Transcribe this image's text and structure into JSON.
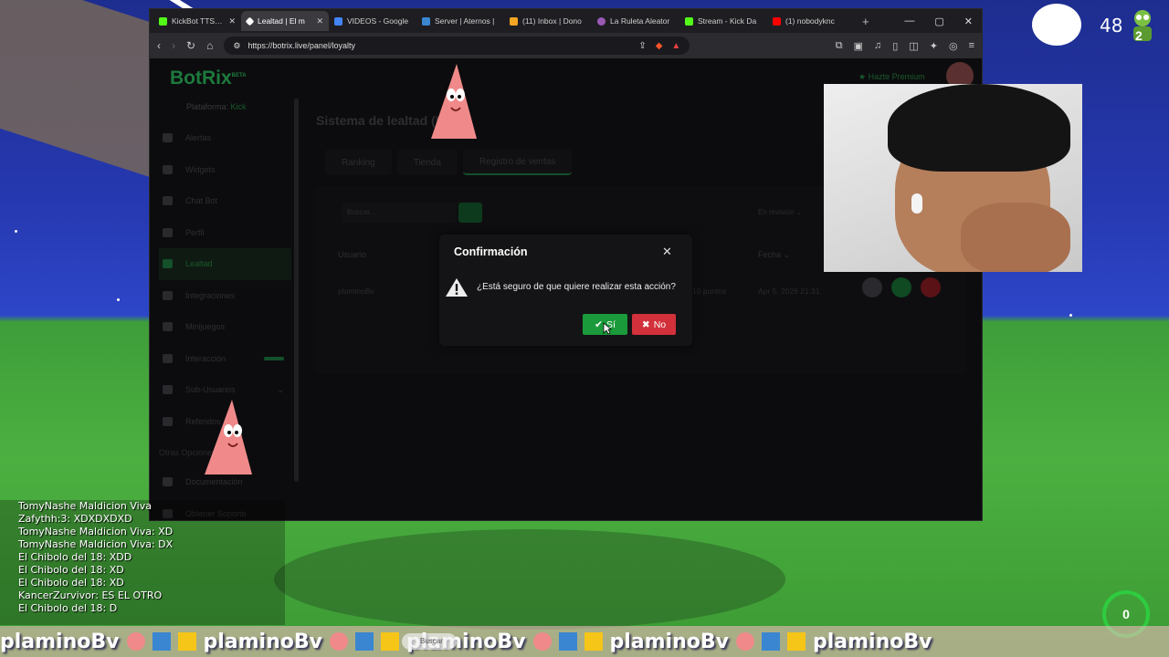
{
  "browser": {
    "tabs": [
      {
        "label": "KickBot TTS Com",
        "color": "#53fc18",
        "active": false
      },
      {
        "label": "Lealtad | El m",
        "color": "#ffffff",
        "active": true
      },
      {
        "label": "VIDEOS - Google",
        "color": "#4285f4",
        "active": false
      },
      {
        "label": "Server | Aternos |",
        "color": "#3a86d1",
        "active": false
      },
      {
        "label": "(11) Inbox | Dono",
        "color": "#f5a623",
        "active": false
      },
      {
        "label": "La Ruleta Aleator",
        "color": "#9b59b6",
        "active": false
      },
      {
        "label": "Stream - Kick Da",
        "color": "#53fc18",
        "active": false
      },
      {
        "label": "(1) nobodyknc",
        "color": "#ff0000",
        "active": false
      }
    ],
    "url": "https://botrix.live/panel/loyalty"
  },
  "page": {
    "logo": "BotRix",
    "logo_badge": "BETA",
    "platform_label": "Plataforma:",
    "platform_value": "Kick",
    "premium": "Hazte Premium",
    "title": "Sistema de lealtad",
    "title_suffix": "(Kick)",
    "sidebar": [
      {
        "label": "Alertas",
        "active": false
      },
      {
        "label": "Widgets",
        "active": false
      },
      {
        "label": "Chat Bot",
        "active": false
      },
      {
        "label": "Perfil",
        "active": false
      },
      {
        "label": "Lealtad",
        "active": true
      },
      {
        "label": "Integraciones",
        "active": false
      },
      {
        "label": "Minijuegos",
        "active": false
      },
      {
        "label": "Interacción",
        "active": false
      },
      {
        "label": "Sub-Usuarios",
        "active": false
      },
      {
        "label": "Referidos",
        "active": false
      }
    ],
    "sidebar_section": "Otras Opciones",
    "sidebar_extra": [
      "Documentación",
      "Obtener Soporte"
    ],
    "tabs": [
      "Ranking",
      "Tienda",
      "Registro de ventas"
    ],
    "search_placeholder": "Buscar...",
    "filter_select": "En revisión",
    "table_headers": {
      "user": "Usuario",
      "date": "Fecha"
    },
    "row": {
      "user": "plaminoBv",
      "points": "10 puntos",
      "date": "Apr 5, 2026 21:31"
    }
  },
  "modal": {
    "title": "Confirmación",
    "message": "¿Está seguro de que quiere realizar esta acción?",
    "yes": "Sí",
    "no": "No"
  },
  "hud": {
    "count": "48",
    "avatar_num": "2",
    "timer": "0"
  },
  "chat": [
    "TomyNashe Maldicion Viva",
    "Zafythh:3: XDXDXDXD",
    "TomyNashe Maldicion Viva: XD",
    "TomyNashe Maldicion Viva: DX",
    "El Chibolo del 18: XDD",
    "El Chibolo del 18: XD",
    "El Chibolo del 18: XD",
    "KancerZurvivor: ES EL OTRO",
    "El Chibolo del 18: D"
  ],
  "strip": {
    "name": "plaminoBv",
    "search": "Buscar"
  }
}
